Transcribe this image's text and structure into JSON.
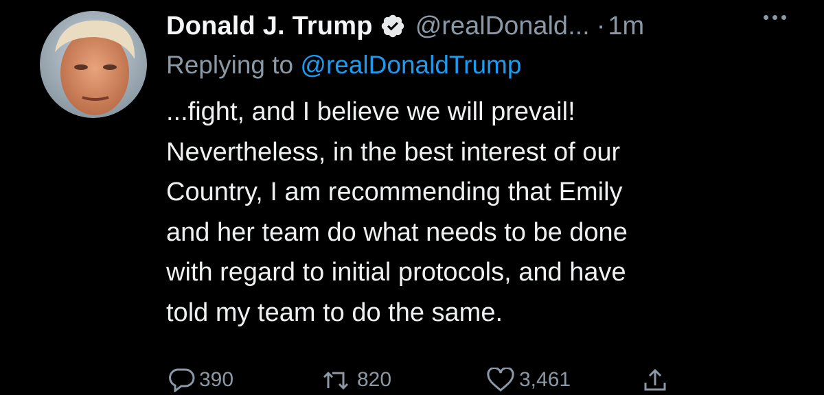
{
  "tweet": {
    "author_name": "Donald J. Trump",
    "handle": "@realDonald...",
    "separator": "·",
    "time": "1m",
    "reply_prefix": "Replying to",
    "reply_mention": "@realDonaldTrump",
    "lines": [
      "...fight, and I believe we will prevail!",
      "Nevertheless, in the best interest of our",
      "Country, I am recommending that Emily",
      "and her team do what needs to be done",
      "with regard to initial protocols, and have",
      "told my team to do the same."
    ],
    "stats": {
      "replies": "390",
      "retweets": "820",
      "likes": "3,461"
    }
  },
  "colors": {
    "background": "#000000",
    "text": "#eef0f1",
    "muted": "#8b98a5",
    "link": "#1d9bf0"
  },
  "icons": [
    "verified-badge-icon",
    "more-options-icon",
    "reply-icon",
    "retweet-icon",
    "like-icon",
    "share-icon"
  ]
}
